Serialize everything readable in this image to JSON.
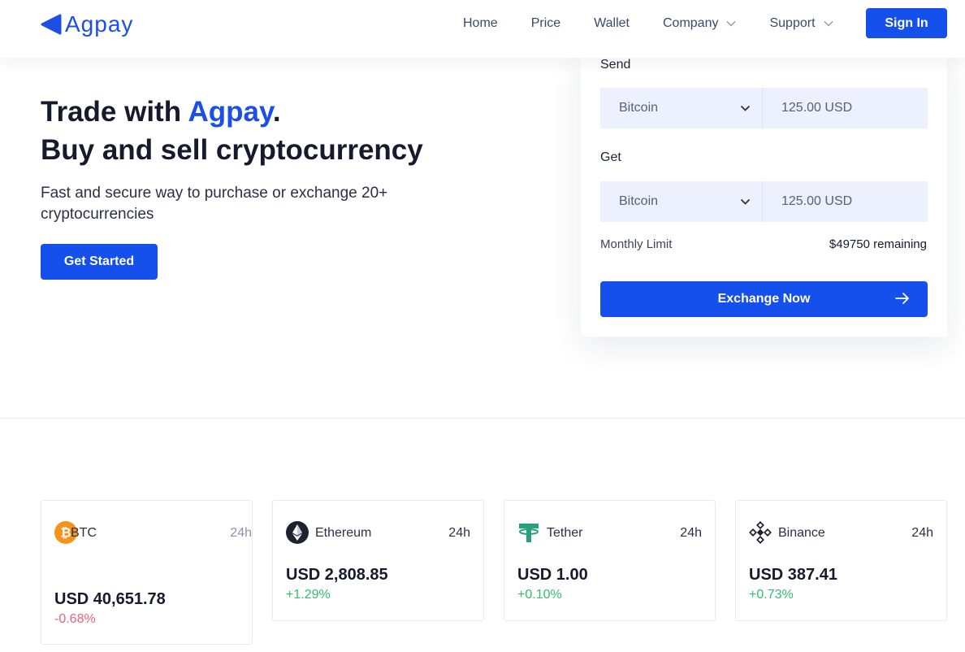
{
  "brand": {
    "name": "Agpay",
    "color": "#1b4fe6"
  },
  "nav": {
    "items": [
      {
        "label": "Home",
        "dropdown": false
      },
      {
        "label": "Price",
        "dropdown": false
      },
      {
        "label": "Wallet",
        "dropdown": false
      },
      {
        "label": "Company",
        "dropdown": true
      },
      {
        "label": "Support",
        "dropdown": true
      }
    ],
    "signin_label": "Sign In"
  },
  "hero": {
    "title_prefix": "Trade with ",
    "title_accent": "Agpay",
    "title_suffix": ".",
    "title_line2": "Buy and sell cryptocurrency",
    "subtitle": "Fast and secure way to purchase or exchange 20+ cryptocurrencies",
    "cta_label": "Get Started"
  },
  "exchange": {
    "send_label": "Send",
    "send_currency": "Bitcoin",
    "send_amount": "125.00 USD",
    "get_label": "Get",
    "get_currency": "Bitcoin",
    "get_amount": "125.00 USD",
    "limit_label": "Monthly Limit",
    "limit_value": "$49750 remaining",
    "button_label": "Exchange Now"
  },
  "tickers": [
    {
      "name": "BTC",
      "period": "24h",
      "price": "USD 40,651.78",
      "change": "-0.68%",
      "direction": "down",
      "icon": "bitcoin-icon"
    },
    {
      "name": "Ethereum",
      "period": "24h",
      "price": "USD 2,808.85",
      "change": "+1.29%",
      "direction": "up",
      "icon": "ethereum-icon"
    },
    {
      "name": "Tether",
      "period": "24h",
      "price": "USD 1.00",
      "change": "+0.10%",
      "direction": "up",
      "icon": "tether-icon"
    },
    {
      "name": "Binance",
      "period": "24h",
      "price": "USD 387.41",
      "change": "+0.73%",
      "direction": "up",
      "icon": "binance-icon"
    }
  ],
  "colors": {
    "primary": "#1650ec",
    "positive": "#2fbf71",
    "negative": "#f0607a",
    "field_bg": "#edf1fd"
  }
}
